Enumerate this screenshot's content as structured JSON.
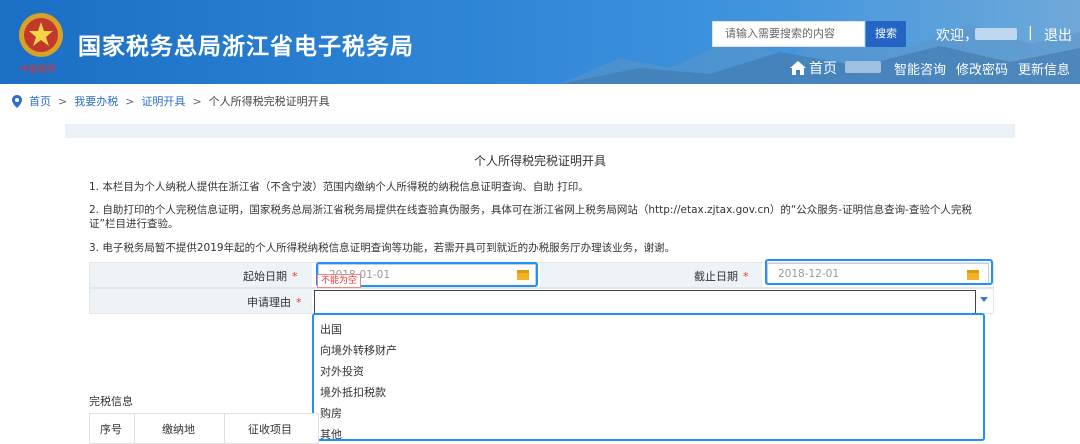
{
  "header": {
    "site_title": "国家税务总局浙江省电子税务局",
    "emblem_text": "中国税务",
    "search_placeholder": "请输入需要搜索的内容",
    "search_button": "搜索",
    "welcome": "欢迎，",
    "separator": "|",
    "logout": "退出",
    "nav": {
      "home": "首页",
      "smart_consult": "智能咨询",
      "change_password": "修改密码",
      "update_info": "更新信息"
    }
  },
  "breadcrumb": {
    "home": "首页",
    "sep": ">",
    "tax": "我要办税",
    "cert": "证明开具",
    "current": "个人所得税完税证明开具"
  },
  "page": {
    "heading": "个人所得税完税证明开具",
    "note1": "1. 本栏目为个人纳税人提供在浙江省（不含宁波）范围内缴纳个人所得税的纳税信息证明查询、自助 打印。",
    "note2": "2. 自助打印的个人完税信息证明，国家税务总局浙江省税务局提供在线查验真伪服务，具体可在浙江省网上税务局网站（http://etax.zjtax.gov.cn）的“公众服务-证明信息查询-查验个人完税证”栏目进行查验。",
    "note3": "3. 电子税务局暂不提供2019年起的个人所得税纳税信息证明查询等功能，若需开具可到就近的办税服务厅办理该业务，谢谢。"
  },
  "form": {
    "start_label": "起始日期",
    "start_value": "2018-01-01",
    "end_label": "截止日期",
    "end_value": "2018-12-01",
    "required_mark": "*",
    "error_tip": "不能为空",
    "reason_label": "申请理由",
    "reason_value": "",
    "reason_options": [
      "出国",
      "向境外转移财产",
      "对外投资",
      "境外抵扣税款",
      "购房",
      "其他"
    ]
  },
  "tax_info": {
    "section_label": "完税信息",
    "columns": [
      "序号",
      "缴纳地",
      "征收项目"
    ]
  },
  "colors": {
    "header_blue": "#2f86d6",
    "highlight": "#1e90ff",
    "required_red": "#e33333",
    "link_blue": "#2a6fc9"
  }
}
